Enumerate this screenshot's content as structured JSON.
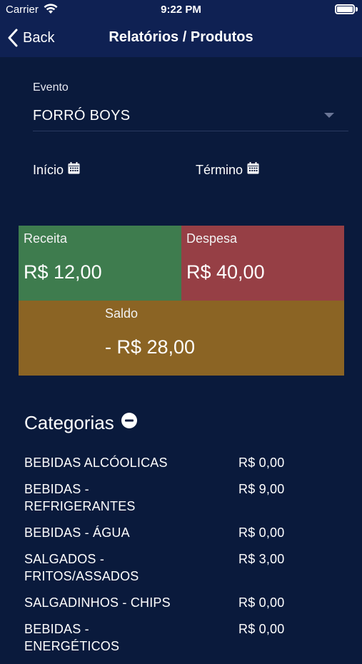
{
  "status_bar": {
    "carrier": "Carrier",
    "time": "9:22 PM"
  },
  "nav": {
    "back_label": "Back",
    "title": "Relatórios / Produtos"
  },
  "filters": {
    "evento_label": "Evento",
    "evento_value": "FORRÓ BOYS",
    "inicio_label": "Início",
    "termino_label": "Término"
  },
  "summary": {
    "receita_label": "Receita",
    "receita_value": "R$ 12,00",
    "despesa_label": "Despesa",
    "despesa_value": "R$ 40,00",
    "saldo_label": "Saldo",
    "saldo_value": "- R$ 28,00"
  },
  "categories": {
    "title": "Categorias",
    "items": [
      {
        "name": "BEBIDAS ALCÓOLICAS",
        "amount": "R$ 0,00"
      },
      {
        "name": "BEBIDAS -\nREFRIGERANTES",
        "amount": "R$ 9,00"
      },
      {
        "name": "BEBIDAS - ÁGUA",
        "amount": "R$ 0,00"
      },
      {
        "name": "SALGADOS -\nFRITOS/ASSADOS",
        "amount": "R$ 3,00"
      },
      {
        "name": "SALGADINHOS - CHIPS",
        "amount": "R$ 0,00"
      },
      {
        "name": "BEBIDAS -\nENERGÉTICOS",
        "amount": "R$ 0,00"
      }
    ]
  },
  "colors": {
    "background": "#0a1a3c",
    "bar": "#0f2153",
    "receita": "#3e7c4e",
    "despesa": "#963f45",
    "saldo": "#8b6424"
  },
  "icons": [
    "wifi-icon",
    "battery-icon",
    "back-chevron-icon",
    "dropdown-caret-icon",
    "calendar-icon",
    "collapse-minus-icon"
  ]
}
